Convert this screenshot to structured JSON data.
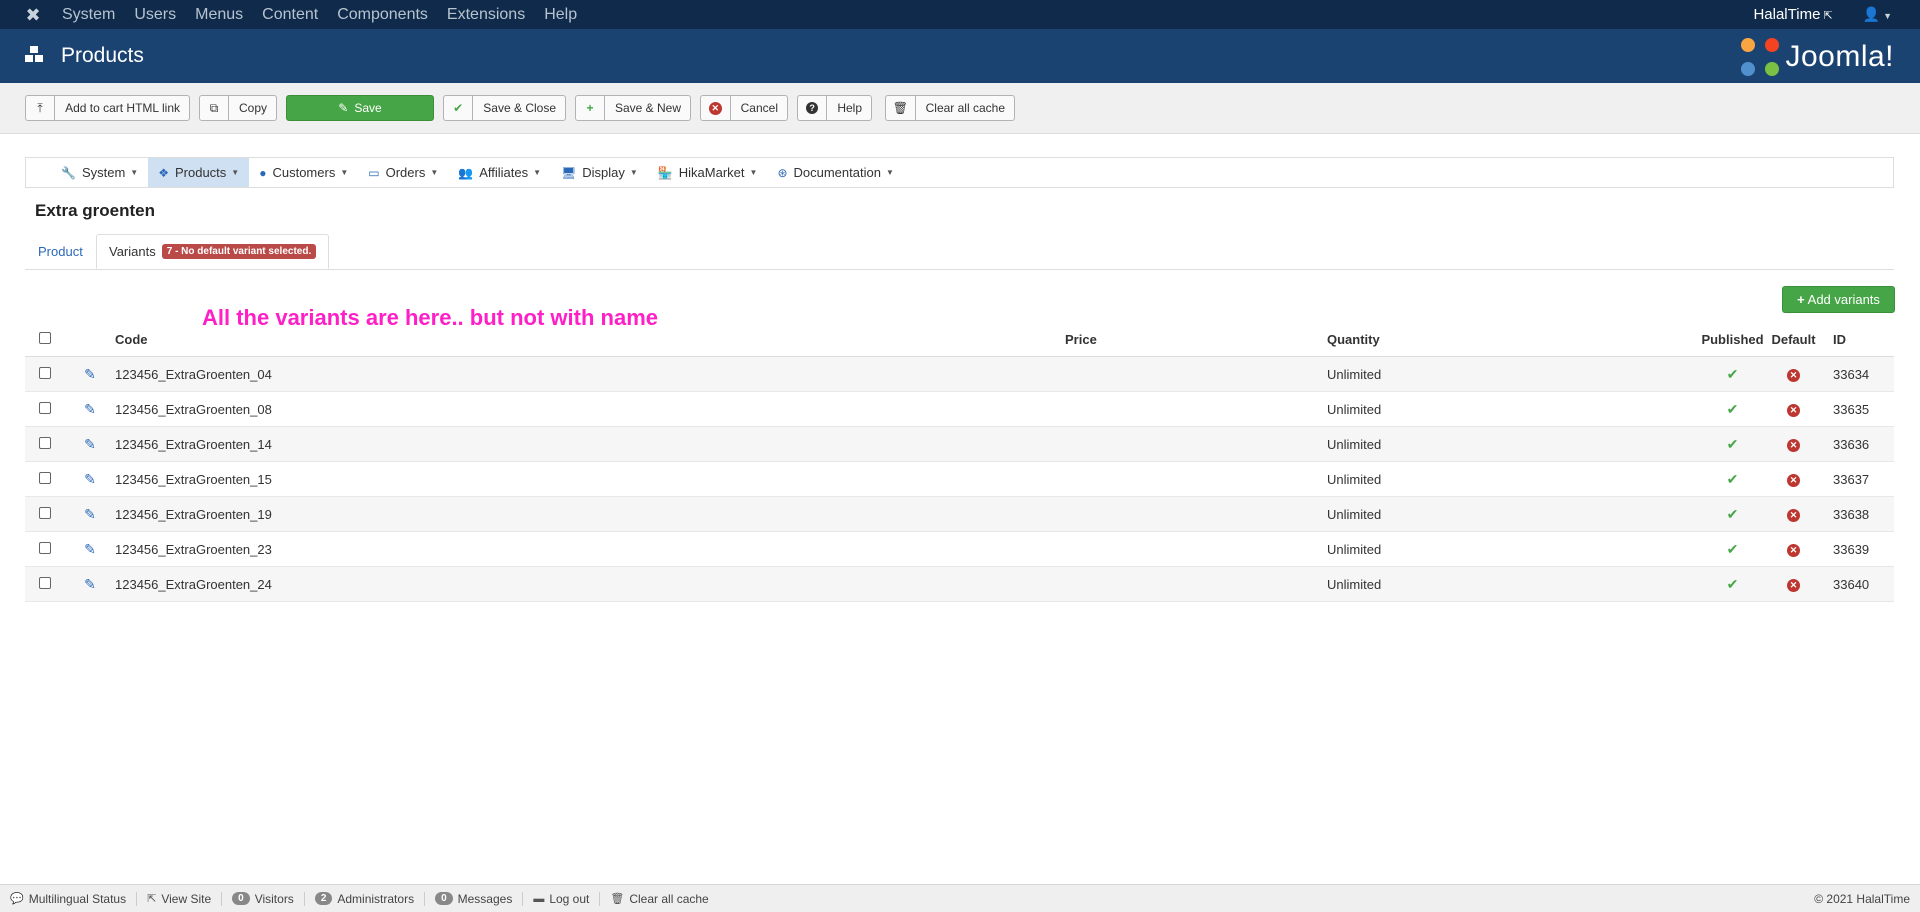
{
  "topbar": {
    "menu": [
      "System",
      "Users",
      "Menus",
      "Content",
      "Components",
      "Extensions",
      "Help"
    ],
    "site_name": "HalalTime"
  },
  "header": {
    "title": "Products",
    "brand": "Joomla!"
  },
  "toolbar": {
    "add_to_cart": "Add to cart HTML link",
    "copy": "Copy",
    "save": "Save",
    "save_close": "Save & Close",
    "save_new": "Save & New",
    "cancel": "Cancel",
    "help": "Help",
    "clear_cache": "Clear all cache"
  },
  "hikamenu": {
    "items": [
      "System",
      "Products",
      "Customers",
      "Orders",
      "Affiliates",
      "Display",
      "HikaMarket",
      "Documentation"
    ]
  },
  "product_name": "Extra groenten",
  "tabs": {
    "product": "Product",
    "variants": "Variants",
    "variants_badge": "7 - No default variant selected."
  },
  "add_variants_label": "Add variants",
  "annotation": "All the variants are here.. but not with name",
  "table": {
    "headers": {
      "code": "Code",
      "price": "Price",
      "quantity": "Quantity",
      "published": "Published",
      "default": "Default",
      "id": "ID"
    },
    "rows": [
      {
        "code": "123456_ExtraGroenten_04",
        "price": "",
        "quantity": "Unlimited",
        "id": "33634"
      },
      {
        "code": "123456_ExtraGroenten_08",
        "price": "",
        "quantity": "Unlimited",
        "id": "33635"
      },
      {
        "code": "123456_ExtraGroenten_14",
        "price": "",
        "quantity": "Unlimited",
        "id": "33636"
      },
      {
        "code": "123456_ExtraGroenten_15",
        "price": "",
        "quantity": "Unlimited",
        "id": "33637"
      },
      {
        "code": "123456_ExtraGroenten_19",
        "price": "",
        "quantity": "Unlimited",
        "id": "33638"
      },
      {
        "code": "123456_ExtraGroenten_23",
        "price": "",
        "quantity": "Unlimited",
        "id": "33639"
      },
      {
        "code": "123456_ExtraGroenten_24",
        "price": "",
        "quantity": "Unlimited",
        "id": "33640"
      }
    ]
  },
  "statusbar": {
    "multilingual": "Multilingual Status",
    "view_site": "View Site",
    "visitors_count": "0",
    "visitors": "Visitors",
    "admins_count": "2",
    "admins": "Administrators",
    "messages_count": "0",
    "messages": "Messages",
    "logout": "Log out",
    "clear_cache": "Clear all cache",
    "copyright": "© 2021 HalalTime"
  },
  "colors": {
    "topbar": "#0f2a4a",
    "header": "#1b4372",
    "success": "#46a546",
    "danger": "#bd362f",
    "link": "#2a69b8",
    "annotation": "#ff1fc6"
  },
  "icons": {
    "joomla_logo": "joomla-logo-icon",
    "products": "cubes-icon",
    "user": "user-icon",
    "upload": "upload-icon",
    "copy": "copy-icon",
    "edit": "pencil-icon",
    "check": "check-icon",
    "plus": "plus-icon",
    "cancel": "times-circle-icon",
    "help": "question-circle-icon",
    "trash": "trash-icon"
  }
}
